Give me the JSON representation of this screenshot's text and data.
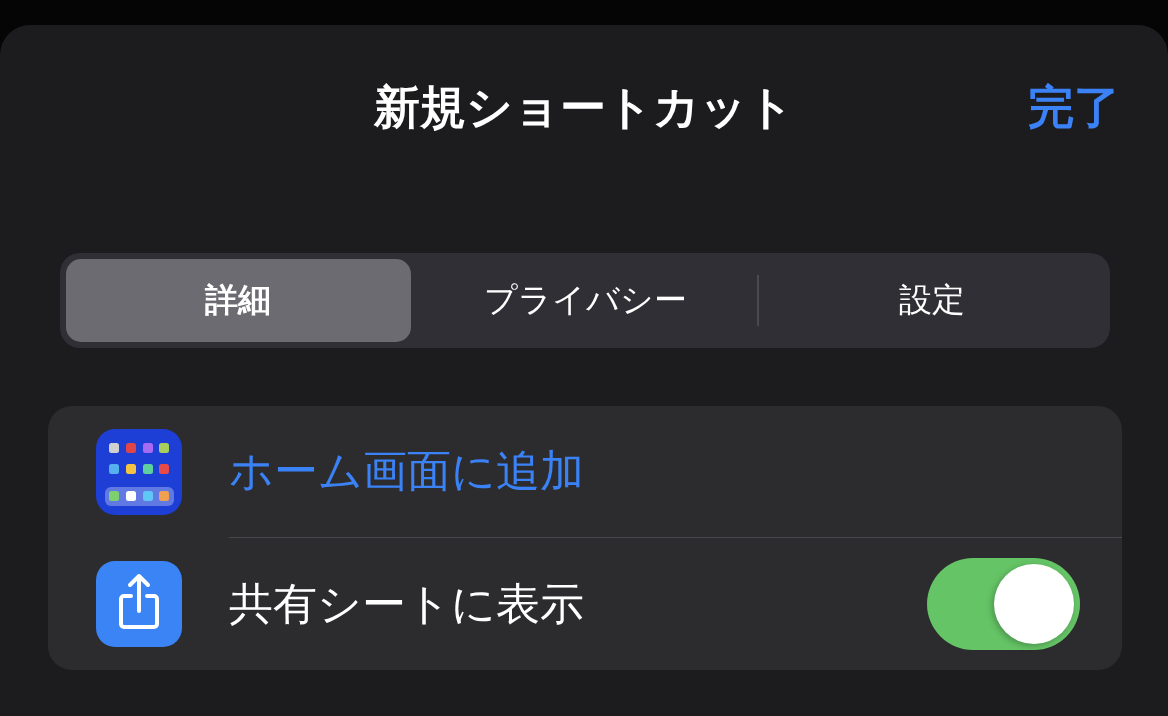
{
  "sheet": {
    "title": "新規ショートカット",
    "done_button": "完了"
  },
  "tabs": [
    {
      "label": "詳細",
      "selected": true
    },
    {
      "label": "プライバシー",
      "selected": false
    },
    {
      "label": "設定",
      "selected": false
    }
  ],
  "rows": [
    {
      "kind": "action",
      "label": "ホーム画面に追加"
    },
    {
      "kind": "toggle",
      "label": "共有シートに表示",
      "on": true
    }
  ]
}
